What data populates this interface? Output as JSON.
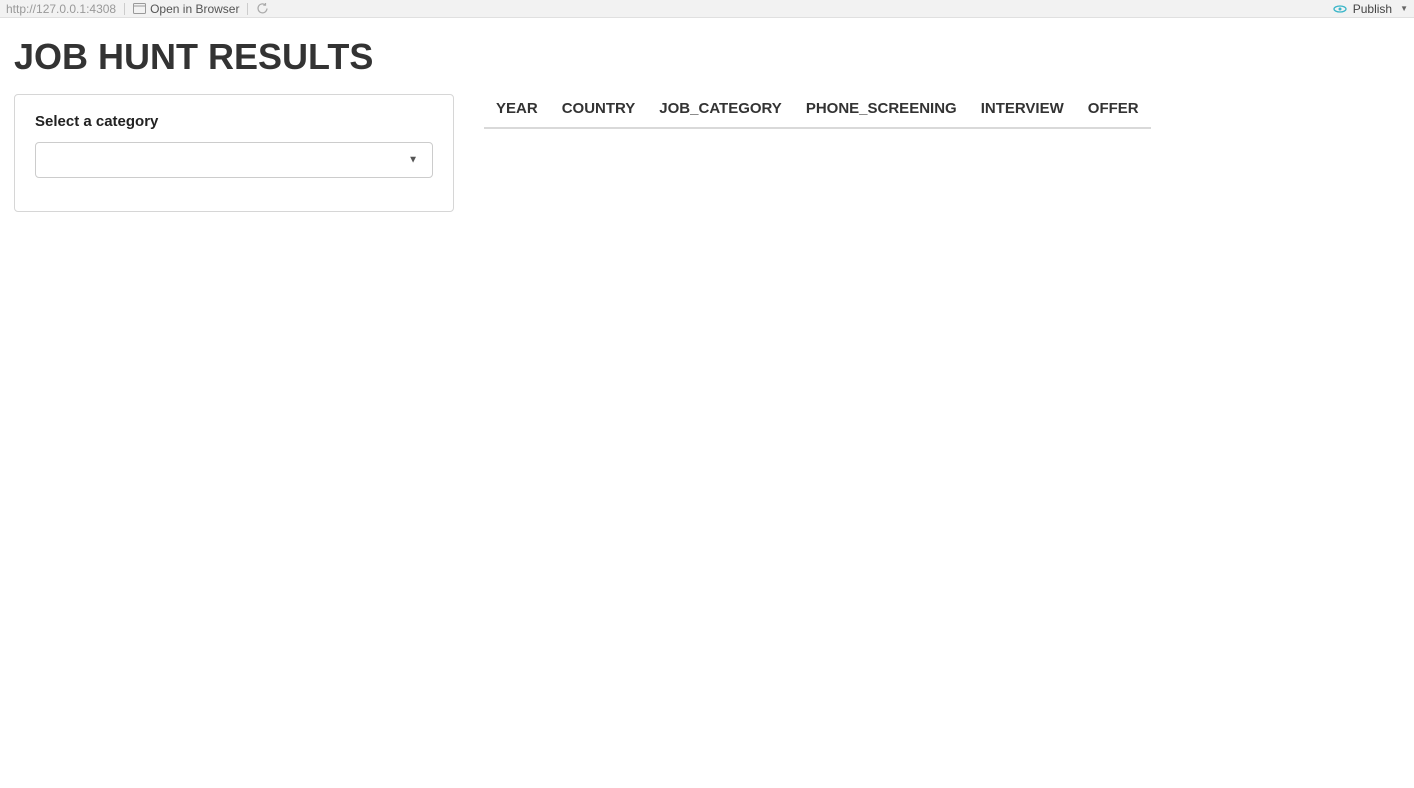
{
  "toolbar": {
    "url": "http://127.0.0.1:4308",
    "open_in_browser": "Open in Browser",
    "publish": "Publish"
  },
  "page": {
    "title": "JOB HUNT RESULTS"
  },
  "sidebar": {
    "select_label": "Select a category",
    "select_value": ""
  },
  "table": {
    "columns": [
      "YEAR",
      "COUNTRY",
      "JOB_CATEGORY",
      "PHONE_SCREENING",
      "INTERVIEW",
      "OFFER"
    ],
    "rows": []
  }
}
